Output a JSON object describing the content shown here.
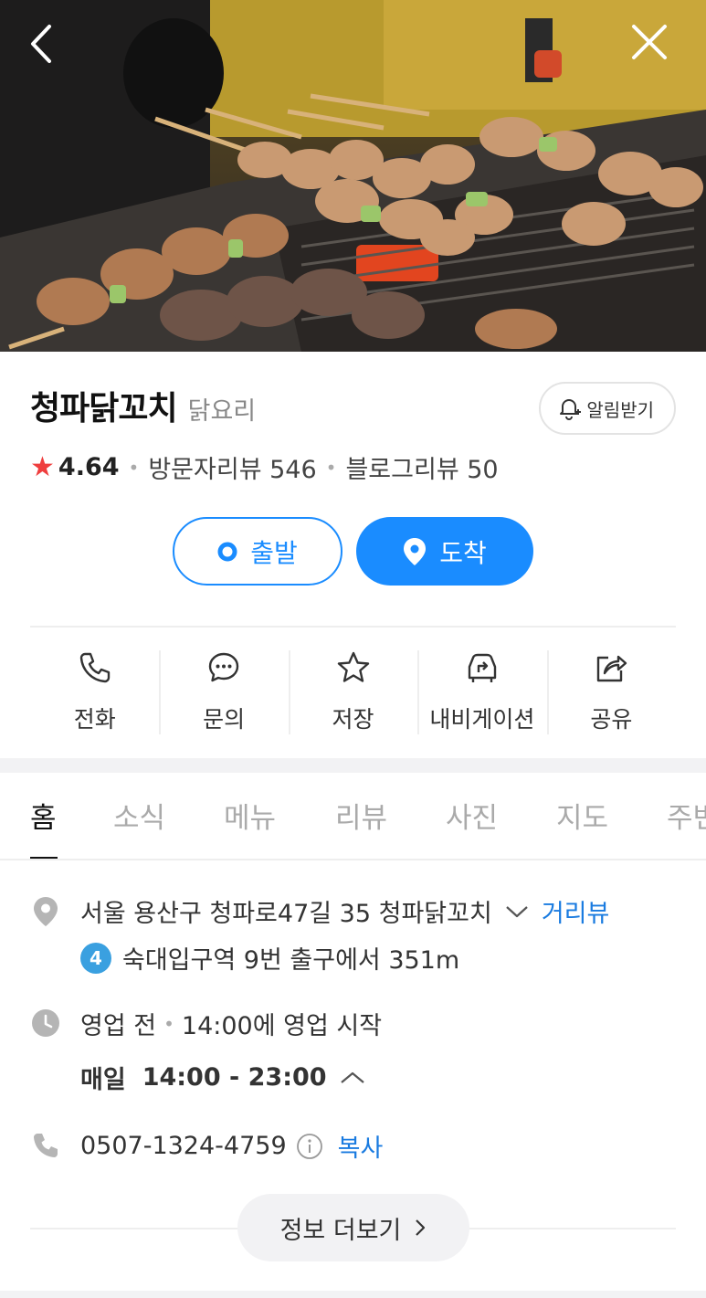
{
  "header": {
    "back_icon": "chevron-left-icon",
    "close_icon": "close-icon"
  },
  "place": {
    "name": "청파닭꼬치",
    "category": "닭요리",
    "alarm_label": "알림받기",
    "rating": "4.64",
    "visitor_reviews": "방문자리뷰 546",
    "blog_reviews": "블로그리뷰 50"
  },
  "route": {
    "start_label": "출발",
    "end_label": "도착"
  },
  "actions": [
    {
      "label": "전화",
      "icon": "phone-icon"
    },
    {
      "label": "문의",
      "icon": "chat-icon"
    },
    {
      "label": "저장",
      "icon": "star-icon"
    },
    {
      "label": "내비게이션",
      "icon": "car-navigation-icon"
    },
    {
      "label": "공유",
      "icon": "share-icon"
    }
  ],
  "tabs": [
    "홈",
    "소식",
    "메뉴",
    "리뷰",
    "사진",
    "지도",
    "주변"
  ],
  "info": {
    "address": "서울 용산구 청파로47길 35 청파닭꼬치",
    "street_view": "거리뷰",
    "subway_line": "4",
    "subway_text": "숙대입구역 9번 출구에서 351m",
    "status": "영업 전",
    "status_detail": "14:00에 영업 시작",
    "hours_day": "매일",
    "hours_time": "14:00 - 23:00",
    "phone": "0507-1324-4759",
    "copy_label": "복사",
    "more_label": "정보 더보기"
  },
  "colors": {
    "accent": "#1a8cff",
    "star": "#ef3e3e",
    "link": "#1a7be0",
    "subway_line4": "#3aa0e0"
  }
}
